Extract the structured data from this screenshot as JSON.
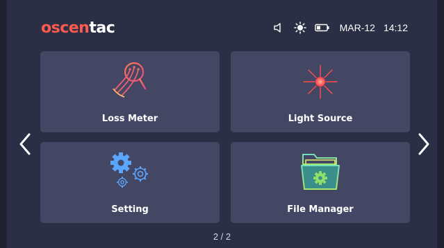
{
  "header": {
    "logo_part1": "oscen",
    "logo_part2": "tac",
    "icons": [
      "speaker-icon",
      "brightness-icon",
      "battery-icon"
    ],
    "date": "MAR-12",
    "time": "14:12"
  },
  "tiles": [
    {
      "label": "Loss Meter",
      "icon": "loss-meter-icon"
    },
    {
      "label": "Light Source",
      "icon": "light-source-icon"
    },
    {
      "label": "Setting",
      "icon": "gears-icon"
    },
    {
      "label": "File Manager",
      "icon": "folder-gear-icon"
    }
  ],
  "pager": {
    "text": "2 / 2"
  },
  "colors": {
    "background": "#2b2f45",
    "tile": "#434764",
    "brand_accent": "#ff5a4e"
  }
}
